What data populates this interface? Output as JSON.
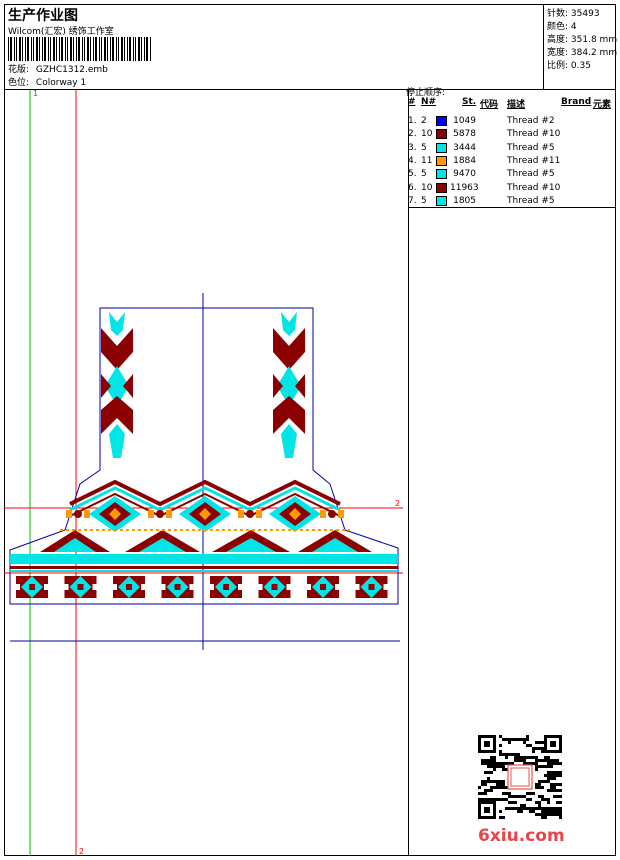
{
  "header": {
    "title": "生产作业图",
    "subtitle": "Wilcom(汇宏) 绣饰工作室",
    "design_label": "花版:",
    "design_value": "GZHC1312.emb",
    "colorway_label": "色位:",
    "colorway_value": "Colorway 1"
  },
  "stats": [
    {
      "label": "针数:",
      "value": "35493"
    },
    {
      "label": "颜色:",
      "value": "4"
    },
    {
      "label": "高度:",
      "value": "351.8 mm"
    },
    {
      "label": "宽度:",
      "value": "384.2 mm"
    },
    {
      "label": "比例:",
      "value": "0.35"
    }
  ],
  "stop_sequence": {
    "title": "停止顺序:",
    "columns": [
      "#",
      "N#",
      "St.",
      "代码",
      "描述",
      "Brand",
      "元素"
    ],
    "rows": [
      {
        "idx": "1.",
        "n": "2",
        "color": "#0000ff",
        "st": "1049",
        "desc": "Thread #2"
      },
      {
        "idx": "2.",
        "n": "10",
        "color": "#8b0000",
        "st": "5878",
        "desc": "Thread #10"
      },
      {
        "idx": "3.",
        "n": "5",
        "color": "#00e5e5",
        "st": "3444",
        "desc": "Thread #5"
      },
      {
        "idx": "4.",
        "n": "11",
        "color": "#ff9900",
        "st": "1884",
        "desc": "Thread #11"
      },
      {
        "idx": "5.",
        "n": "5",
        "color": "#00e5e5",
        "st": "9470",
        "desc": "Thread #5"
      },
      {
        "idx": "6.",
        "n": "10",
        "color": "#8b0000",
        "st": "11963",
        "desc": "Thread #10"
      },
      {
        "idx": "7.",
        "n": "5",
        "color": "#00e5e5",
        "st": "1805",
        "desc": "Thread #5"
      }
    ]
  },
  "guides": {
    "v1": "1",
    "v2": "2",
    "h2": "2"
  },
  "colors": {
    "maroon": "#8b0000",
    "cyan": "#00e5e5",
    "blue": "#0000ff",
    "orange": "#ff9900",
    "red": "#ff0000",
    "green": "#00c000",
    "navy": "#0000aa"
  },
  "watermark": "6xiu.com"
}
